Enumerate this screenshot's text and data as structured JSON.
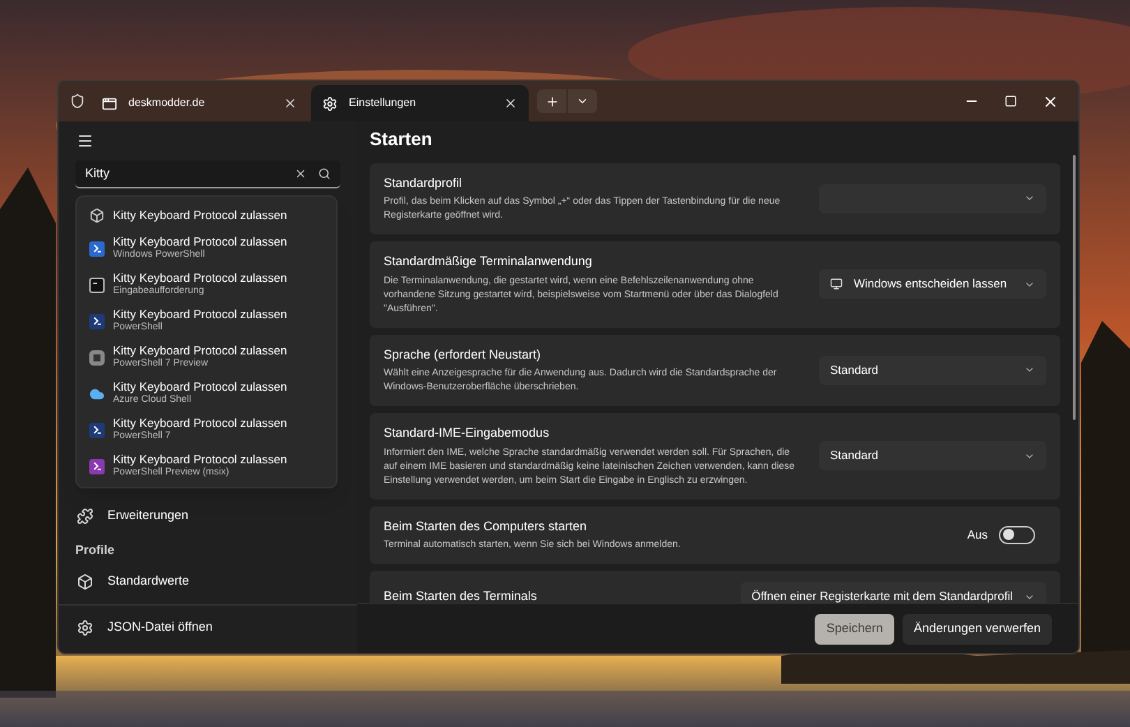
{
  "tabs": [
    {
      "title": "deskmodder.de",
      "kind": "browser",
      "selected": false
    },
    {
      "title": "Einstellungen",
      "kind": "gear",
      "selected": true
    }
  ],
  "search": {
    "value": "Kitty"
  },
  "search_results": [
    {
      "title": "Kitty Keyboard Protocol zulassen",
      "kind": "cube"
    },
    {
      "title": "Kitty Keyboard Protocol zulassen",
      "subtitle": "Windows PowerShell",
      "kind": "powershell"
    },
    {
      "title": "Kitty Keyboard Protocol zulassen",
      "subtitle": "Eingabeaufforderung",
      "kind": "cmd"
    },
    {
      "title": "Kitty Keyboard Protocol zulassen",
      "subtitle": "PowerShell",
      "kind": "powershell-dark"
    },
    {
      "title": "Kitty Keyboard Protocol zulassen",
      "subtitle": "PowerShell 7 Preview",
      "kind": "generic"
    },
    {
      "title": "Kitty Keyboard Protocol zulassen",
      "subtitle": "Azure Cloud Shell",
      "kind": "cloud"
    },
    {
      "title": "Kitty Keyboard Protocol zulassen",
      "subtitle": "PowerShell 7",
      "kind": "powershell-dark"
    },
    {
      "title": "Kitty Keyboard Protocol zulassen",
      "subtitle": "PowerShell Preview (msix)",
      "kind": "powershell-msix"
    }
  ],
  "sidebar": {
    "items": [
      {
        "label": "Erweiterungen",
        "kind": "puzzle"
      }
    ],
    "section": "Profile",
    "profiles": [
      {
        "label": "Standardwerte",
        "kind": "cube"
      }
    ],
    "footer": {
      "label": "JSON-Datei öffnen",
      "kind": "gear"
    }
  },
  "page_title": "Starten",
  "settings": [
    {
      "kind": "dropdown",
      "title": "Standardprofil",
      "description": "Profil, das beim Klicken auf das Symbol „+“ oder das Tippen der Tastenbindung für die neue Registerkarte geöffnet wird."
    },
    {
      "kind": "icon-dropdown",
      "title": "Standardmäßige Terminalanwendung",
      "description": "Die Terminalanwendung, die gestartet wird, wenn eine Befehlszeilenanwendung ohne vorhandene Sitzung gestartet wird, beispielsweise vom Startmenü oder über das Dialogfeld \"Ausführen\".",
      "value": "Windows entscheiden lassen"
    },
    {
      "kind": "dropdown",
      "title": "Sprache (erfordert Neustart)",
      "description": "Wählt eine Anzeigesprache für die Anwendung aus. Dadurch wird die Standardsprache der Windows-Benutzeroberfläche überschrieben.",
      "value": "Standard"
    },
    {
      "kind": "dropdown",
      "title": "Standard-IME-Eingabemodus",
      "description": "Informiert den IME, welche Sprache standardmäßig verwendet werden soll. Für Sprachen, die auf einem IME basieren und standardmäßig keine lateinischen Zeichen verwenden, kann diese Einstellung verwendet werden, um beim Start die Eingabe in Englisch zu erzwingen.",
      "value": "Standard"
    },
    {
      "kind": "toggle",
      "title": "Beim Starten des Computers starten",
      "description": "Terminal automatisch starten, wenn Sie sich bei Windows anmelden.",
      "value": "Aus",
      "on": false
    },
    {
      "kind": "dropdown",
      "title": "Beim Starten des Terminals",
      "value": "Öffnen einer Registerkarte mit dem Standardprofil"
    }
  ],
  "buttons": [
    {
      "label": "Speichern",
      "disabled": true
    },
    {
      "label": "Änderungen verwerfen",
      "disabled": false
    }
  ]
}
